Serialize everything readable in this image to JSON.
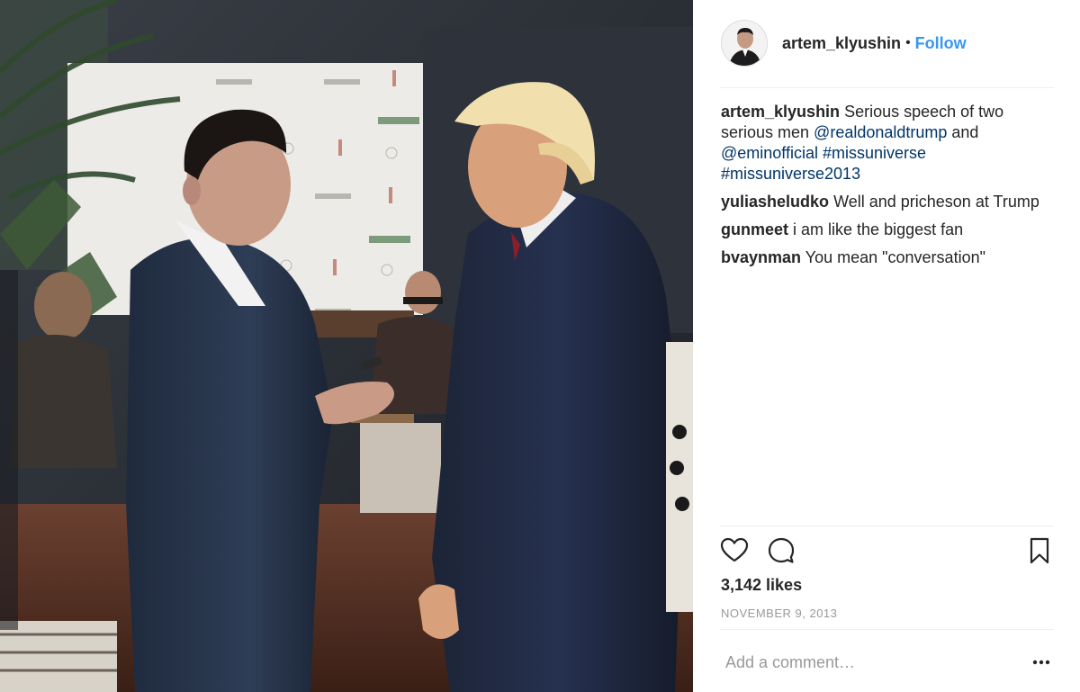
{
  "post": {
    "photo_icon": "photo",
    "header": {
      "avatar_icon": "avatar",
      "username": "artem_klyushin",
      "separator": "•",
      "follow_label": "Follow"
    },
    "caption": {
      "author": "artem_klyushin",
      "text_1": "Serious speech of two serious men ",
      "mention_1": "@realdonaldtrump",
      "text_2": " and ",
      "mention_2": "@eminofficial",
      "text_3": " ",
      "tag_1": "#missuniverse",
      "text_4": " ",
      "tag_2": "#missuniverse2013"
    },
    "comments": [
      {
        "author": "yuliasheludko",
        "text": "Well and pricheson at Trump"
      },
      {
        "author": "gunmeet",
        "text": "i am like the biggest fan"
      },
      {
        "author": "bvaynman",
        "text": "You mean \"conversation\""
      }
    ],
    "actions": {
      "like_icon": "heart-icon",
      "comment_icon": "comment-icon",
      "save_icon": "bookmark-icon"
    },
    "likes": "3,142 likes",
    "date": "NOVEMBER 9, 2013",
    "add_comment_placeholder": "Add a comment…",
    "more_icon": "ellipsis-icon"
  }
}
